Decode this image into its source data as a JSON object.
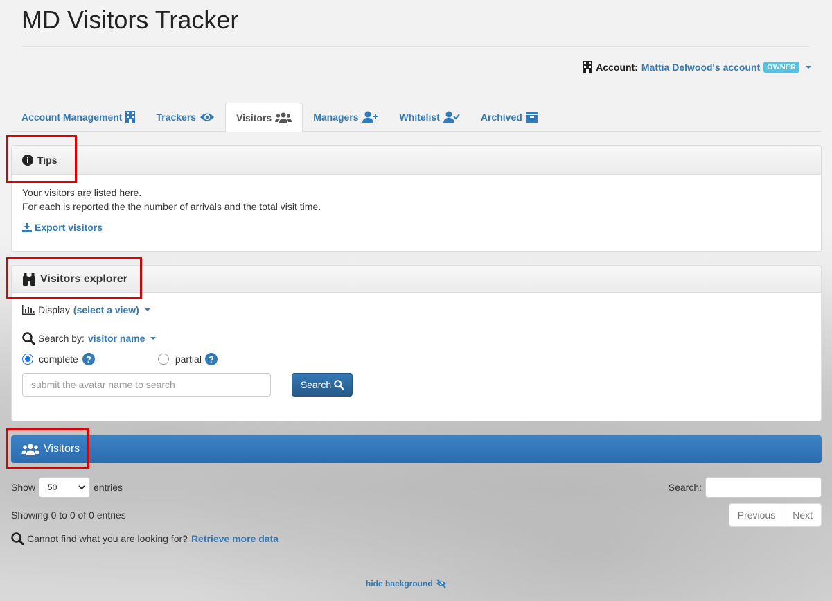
{
  "app": {
    "title": "MD Visitors Tracker"
  },
  "account": {
    "label": "Account:",
    "name": "Mattia Delwood's account",
    "badge": "OWNER"
  },
  "tabs": [
    {
      "label": "Account Management",
      "icon": "building-icon"
    },
    {
      "label": "Trackers",
      "icon": "eye-icon"
    },
    {
      "label": "Visitors",
      "icon": "users-icon",
      "active": true
    },
    {
      "label": "Managers",
      "icon": "user-plus-icon"
    },
    {
      "label": "Whitelist",
      "icon": "user-check-icon"
    },
    {
      "label": "Archived",
      "icon": "archive-icon"
    }
  ],
  "tips": {
    "title": "Tips",
    "line1": "Your visitors are listed here.",
    "line2": "For each is reported the the number of arrivals and the total visit time.",
    "export_label": "Export visitors"
  },
  "explorer": {
    "title": "Visitors explorer",
    "display_label": "Display",
    "display_value": "(select a view)",
    "search_by_label": "Search by:",
    "search_by_value": "visitor name",
    "radio_complete": "complete",
    "radio_partial": "partial",
    "search_placeholder": "submit the avatar name to search",
    "search_button": "Search"
  },
  "visitors": {
    "title": "Visitors",
    "show_label": "Show",
    "entries_value": "50",
    "entries_label": "entries",
    "search_label": "Search:",
    "showing": "Showing 0 to 0 of 0 entries",
    "previous": "Previous",
    "next": "Next",
    "cannot_find": "Cannot find what you are looking for?",
    "retrieve_more": "Retrieve more data"
  },
  "footer": {
    "hide_background": "hide background"
  },
  "colors": {
    "link": "#337ab7",
    "badge": "#5bc0de",
    "highlight": "#e00000",
    "primary_bar": "#2f75b8"
  }
}
